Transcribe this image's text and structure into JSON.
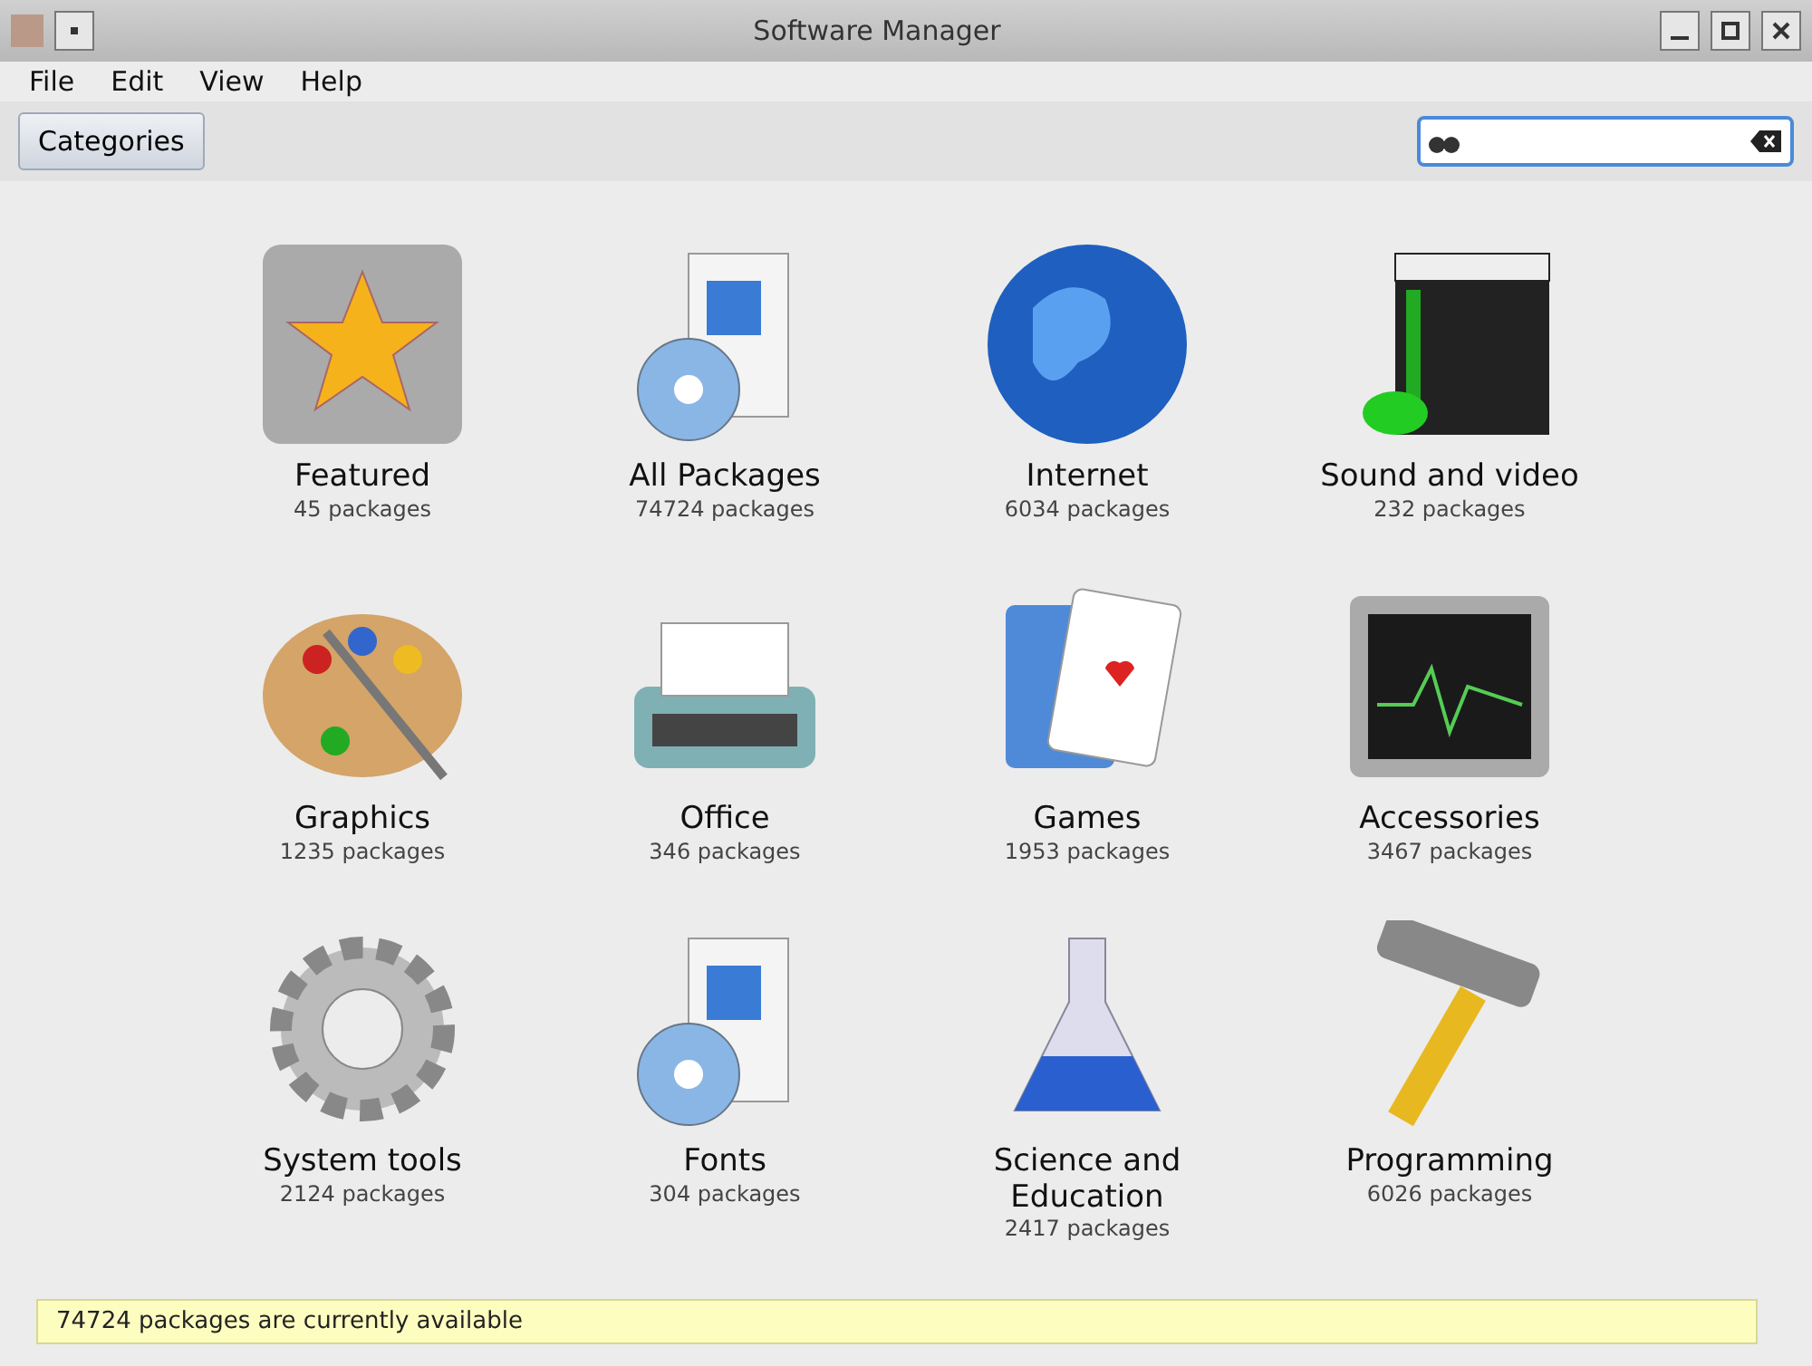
{
  "window": {
    "title": "Software Manager"
  },
  "menu": [
    "File",
    "Edit",
    "View",
    "Help"
  ],
  "toolbar": {
    "button": "Categories"
  },
  "categories": [
    {
      "name": "Featured",
      "count": "45 packages"
    },
    {
      "name": "All Packages",
      "count": "74724 packages"
    },
    {
      "name": "Internet",
      "count": "6034 packages"
    },
    {
      "name": "Sound and video",
      "count": "232 packages"
    },
    {
      "name": "Graphics",
      "count": "1235 packages"
    },
    {
      "name": "Office",
      "count": "346 packages"
    },
    {
      "name": "Games",
      "count": "1953 packages"
    },
    {
      "name": "Accessories",
      "count": "3467 packages"
    },
    {
      "name": "System tools",
      "count": "2124 packages"
    },
    {
      "name": "Fonts",
      "count": "304 packages"
    },
    {
      "name": "Science and Education",
      "count": "2417 packages"
    },
    {
      "name": "Programming",
      "count": "6026 packages"
    }
  ],
  "status_bar": "74724 packages are currently available"
}
